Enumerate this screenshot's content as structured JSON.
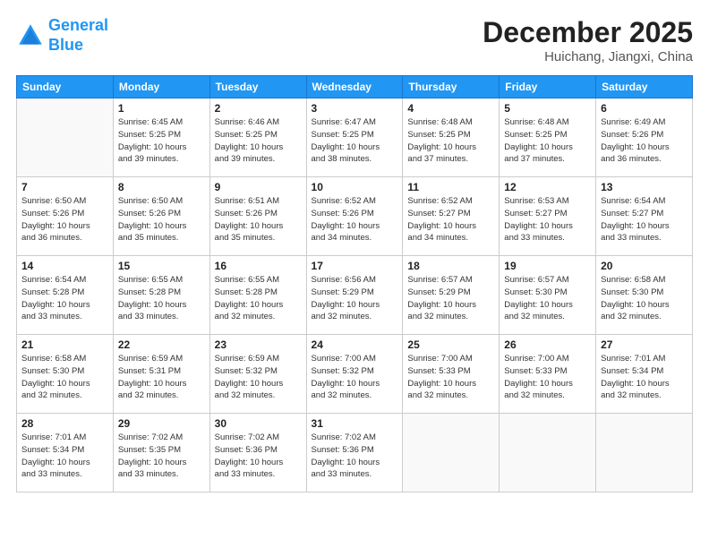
{
  "header": {
    "logo_line1": "General",
    "logo_line2": "Blue",
    "month": "December 2025",
    "location": "Huichang, Jiangxi, China"
  },
  "days_of_week": [
    "Sunday",
    "Monday",
    "Tuesday",
    "Wednesday",
    "Thursday",
    "Friday",
    "Saturday"
  ],
  "weeks": [
    [
      {
        "day": "",
        "info": ""
      },
      {
        "day": "1",
        "info": "Sunrise: 6:45 AM\nSunset: 5:25 PM\nDaylight: 10 hours\nand 39 minutes."
      },
      {
        "day": "2",
        "info": "Sunrise: 6:46 AM\nSunset: 5:25 PM\nDaylight: 10 hours\nand 39 minutes."
      },
      {
        "day": "3",
        "info": "Sunrise: 6:47 AM\nSunset: 5:25 PM\nDaylight: 10 hours\nand 38 minutes."
      },
      {
        "day": "4",
        "info": "Sunrise: 6:48 AM\nSunset: 5:25 PM\nDaylight: 10 hours\nand 37 minutes."
      },
      {
        "day": "5",
        "info": "Sunrise: 6:48 AM\nSunset: 5:25 PM\nDaylight: 10 hours\nand 37 minutes."
      },
      {
        "day": "6",
        "info": "Sunrise: 6:49 AM\nSunset: 5:26 PM\nDaylight: 10 hours\nand 36 minutes."
      }
    ],
    [
      {
        "day": "7",
        "info": "Sunrise: 6:50 AM\nSunset: 5:26 PM\nDaylight: 10 hours\nand 36 minutes."
      },
      {
        "day": "8",
        "info": "Sunrise: 6:50 AM\nSunset: 5:26 PM\nDaylight: 10 hours\nand 35 minutes."
      },
      {
        "day": "9",
        "info": "Sunrise: 6:51 AM\nSunset: 5:26 PM\nDaylight: 10 hours\nand 35 minutes."
      },
      {
        "day": "10",
        "info": "Sunrise: 6:52 AM\nSunset: 5:26 PM\nDaylight: 10 hours\nand 34 minutes."
      },
      {
        "day": "11",
        "info": "Sunrise: 6:52 AM\nSunset: 5:27 PM\nDaylight: 10 hours\nand 34 minutes."
      },
      {
        "day": "12",
        "info": "Sunrise: 6:53 AM\nSunset: 5:27 PM\nDaylight: 10 hours\nand 33 minutes."
      },
      {
        "day": "13",
        "info": "Sunrise: 6:54 AM\nSunset: 5:27 PM\nDaylight: 10 hours\nand 33 minutes."
      }
    ],
    [
      {
        "day": "14",
        "info": "Sunrise: 6:54 AM\nSunset: 5:28 PM\nDaylight: 10 hours\nand 33 minutes."
      },
      {
        "day": "15",
        "info": "Sunrise: 6:55 AM\nSunset: 5:28 PM\nDaylight: 10 hours\nand 33 minutes."
      },
      {
        "day": "16",
        "info": "Sunrise: 6:55 AM\nSunset: 5:28 PM\nDaylight: 10 hours\nand 32 minutes."
      },
      {
        "day": "17",
        "info": "Sunrise: 6:56 AM\nSunset: 5:29 PM\nDaylight: 10 hours\nand 32 minutes."
      },
      {
        "day": "18",
        "info": "Sunrise: 6:57 AM\nSunset: 5:29 PM\nDaylight: 10 hours\nand 32 minutes."
      },
      {
        "day": "19",
        "info": "Sunrise: 6:57 AM\nSunset: 5:30 PM\nDaylight: 10 hours\nand 32 minutes."
      },
      {
        "day": "20",
        "info": "Sunrise: 6:58 AM\nSunset: 5:30 PM\nDaylight: 10 hours\nand 32 minutes."
      }
    ],
    [
      {
        "day": "21",
        "info": "Sunrise: 6:58 AM\nSunset: 5:30 PM\nDaylight: 10 hours\nand 32 minutes."
      },
      {
        "day": "22",
        "info": "Sunrise: 6:59 AM\nSunset: 5:31 PM\nDaylight: 10 hours\nand 32 minutes."
      },
      {
        "day": "23",
        "info": "Sunrise: 6:59 AM\nSunset: 5:32 PM\nDaylight: 10 hours\nand 32 minutes."
      },
      {
        "day": "24",
        "info": "Sunrise: 7:00 AM\nSunset: 5:32 PM\nDaylight: 10 hours\nand 32 minutes."
      },
      {
        "day": "25",
        "info": "Sunrise: 7:00 AM\nSunset: 5:33 PM\nDaylight: 10 hours\nand 32 minutes."
      },
      {
        "day": "26",
        "info": "Sunrise: 7:00 AM\nSunset: 5:33 PM\nDaylight: 10 hours\nand 32 minutes."
      },
      {
        "day": "27",
        "info": "Sunrise: 7:01 AM\nSunset: 5:34 PM\nDaylight: 10 hours\nand 32 minutes."
      }
    ],
    [
      {
        "day": "28",
        "info": "Sunrise: 7:01 AM\nSunset: 5:34 PM\nDaylight: 10 hours\nand 33 minutes."
      },
      {
        "day": "29",
        "info": "Sunrise: 7:02 AM\nSunset: 5:35 PM\nDaylight: 10 hours\nand 33 minutes."
      },
      {
        "day": "30",
        "info": "Sunrise: 7:02 AM\nSunset: 5:36 PM\nDaylight: 10 hours\nand 33 minutes."
      },
      {
        "day": "31",
        "info": "Sunrise: 7:02 AM\nSunset: 5:36 PM\nDaylight: 10 hours\nand 33 minutes."
      },
      {
        "day": "",
        "info": ""
      },
      {
        "day": "",
        "info": ""
      },
      {
        "day": "",
        "info": ""
      }
    ]
  ]
}
